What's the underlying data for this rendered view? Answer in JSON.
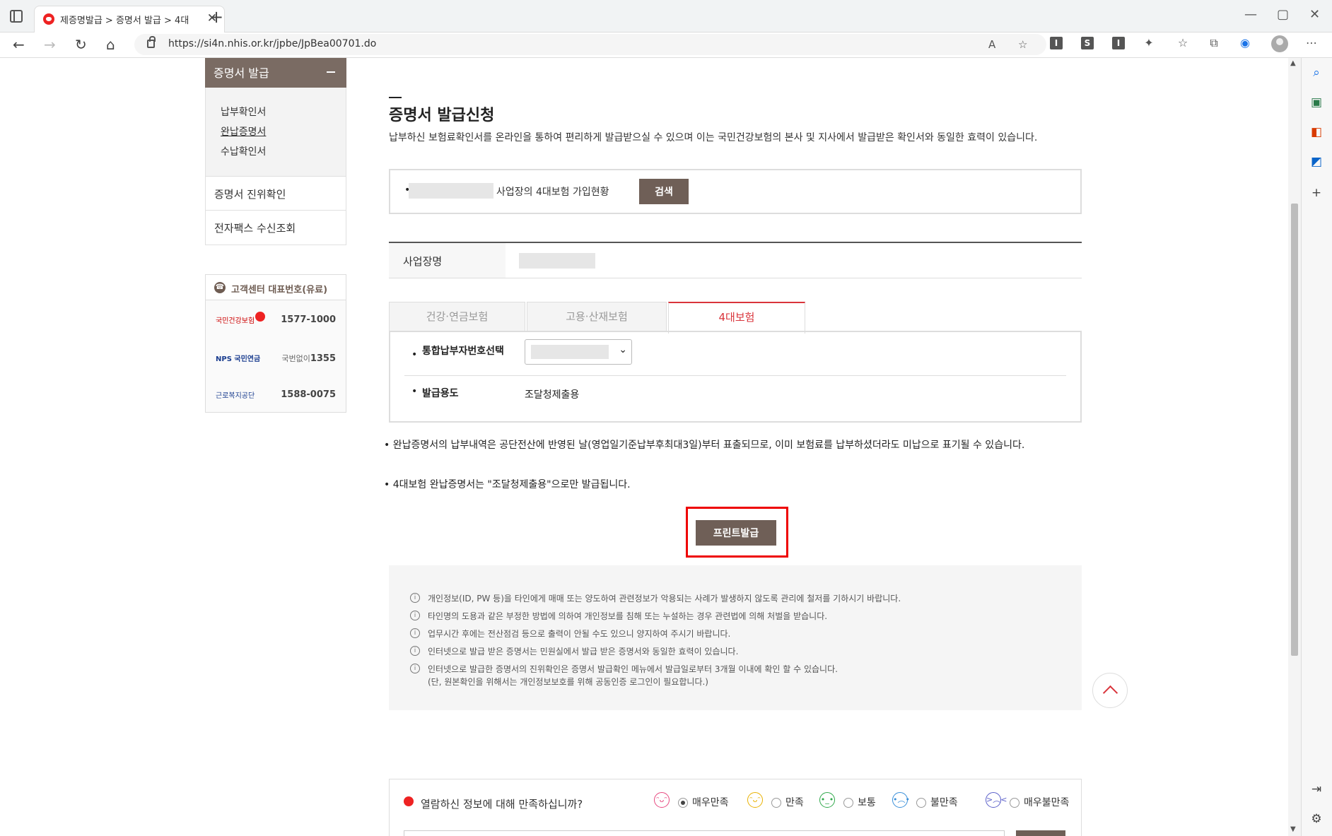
{
  "browser": {
    "tab_title": "제증명발급 > 증명서 발급 > 4대",
    "url": "https://si4n.nhis.or.kr/jpbe/JpBea00701.do",
    "window_controls": [
      "—",
      "▢",
      "✕"
    ]
  },
  "lnb": {
    "header": "증명서 발급",
    "sub_items": [
      "납부확인서",
      "완납증명서",
      "수납확인서"
    ],
    "items": [
      "증명서 진위확인",
      "전자팩스 수신조회"
    ]
  },
  "customer_center": {
    "title": "고객센터 대표번호(유료)",
    "rows": [
      {
        "logo": "국민건강보험",
        "number": "1577-1000"
      },
      {
        "logo": "NPS 국민연금",
        "prefix": "국번없이",
        "number": "1355"
      },
      {
        "logo": "근로복지공단",
        "number": "1588-0075"
      }
    ]
  },
  "main": {
    "title": "증명서 발급신청",
    "description": "납부하신 보험료확인서를 온라인을 통하여 편리하게 발급받으실 수 있으며 이는 국민건강보험의 본사 및 지사에서 발급받은 확인서와 동일한 효력이 있습니다.",
    "search_label": "사업장의 4대보험 가입현황",
    "search_button": "검색",
    "biz_name_label": "사업장명",
    "tabs": [
      "건강·연금보험",
      "고용·산재보험",
      "4대보험"
    ],
    "form": {
      "payer_label": "통합납부자번호선택",
      "purpose_label": "발급용도",
      "purpose_value": "조달청제출용"
    },
    "notices": [
      "• 완납증명서의 납부내역은 공단전산에 반영된 날(영업일기준납부후최대3일)부터 표출되므로, 이미 보험료를 납부하셨더라도 미납으로 표기될 수 있습니다.",
      "• 4대보험 완납증명서는 \"조달청제출용\"으로만 발급됩니다."
    ],
    "print_button": "프린트발급",
    "info_lines": [
      "개인정보(ID, PW 등)을 타인에게 매매 또는 양도하여 관련정보가 악용되는 사례가 발생하지 않도록 관리에 철저를 기하시기 바랍니다.",
      "타인명의 도용과 같은 부정한 방법에 의하여 개인정보를 침해 또는 누설하는 경우 관련법에 의해 처벌을 받습니다.",
      "업무시간 후에는 전산점검 등으로 출력이 안될 수도 있으니 양지하여 주시기 바랍니다.",
      "인터넷으로 발급 받은 증명서는 민원실에서 발급 받은 증명서와 동일한 효력이 있습니다.",
      "인터넷으로 발급한 증명서의 진위확인은 증명서 발급확인 메뉴에서 발급일로부터 3개월 이내에 확인 할 수 있습니다.",
      "(단, 원본확인을 위해서는 개인정보보호를 위해 공동인증 로그인이 필요합니다.)"
    ]
  },
  "survey": {
    "question": "열람하신 정보에 대해 만족하십니까?",
    "options": [
      "매우만족",
      "만족",
      "보통",
      "불만족",
      "매우불만족"
    ],
    "selected": "매우만족"
  },
  "colors": {
    "brand_brown": "#6f5f57",
    "accent_red": "#d9343b",
    "highlight_red": "#ee0000"
  }
}
